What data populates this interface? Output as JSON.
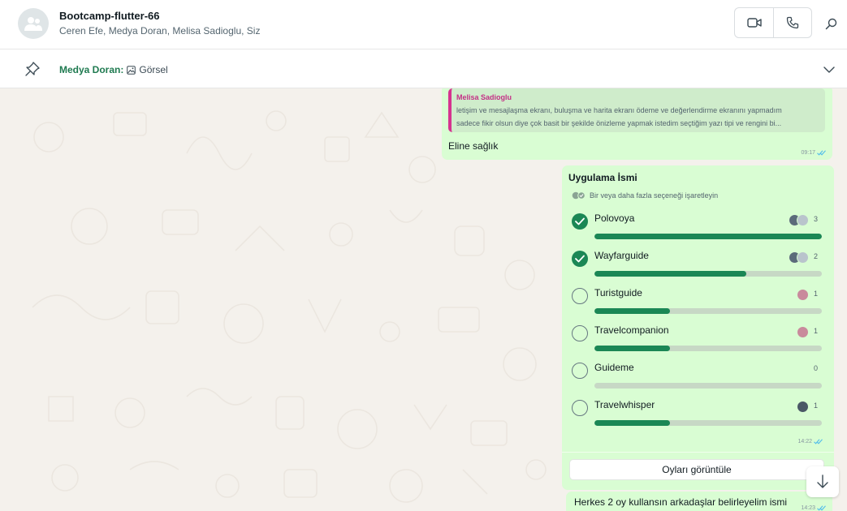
{
  "header": {
    "title": "Bootcamp-flutter-66",
    "members": "Ceren Efe, Medya Doran, Melisa Sadioglu, Siz",
    "icons": {
      "avatar": "group-avatar-icon",
      "video": "video-call-icon",
      "voice": "voice-call-icon",
      "search": "search-icon"
    }
  },
  "pinned": {
    "sender": "Medya Doran:",
    "message": "Görsel",
    "icons": {
      "pin": "pin-icon",
      "image": "image-icon",
      "expand": "chevron-down-icon"
    }
  },
  "messages": {
    "reply": {
      "quote_author": "Melisa Sadioglu",
      "quote_line1": "letişim ve mesajlaşma ekranı, buluşma ve harita ekranı ödeme ve değerlendirme ekranını yapmadım",
      "quote_line2": "sadece fikir olsun diye çok basit bir şekilde önizleme yapmak istedim seçtiğim yazı tipi ve rengini bi...",
      "text": "Eline sağlık",
      "time": "09:17"
    },
    "poll": {
      "title": "Uygulama İsmi",
      "hint": "Bir veya daha fazla seçeneği işaretleyin",
      "time": "14:22",
      "view_votes": "Oyları görüntüle",
      "options": [
        {
          "label": "Polovoya",
          "votes": "3",
          "checked": true,
          "fraction": 1.0
        },
        {
          "label": "Wayfarguide",
          "votes": "2",
          "checked": true,
          "fraction": 0.667
        },
        {
          "label": "Turistguide",
          "votes": "1",
          "checked": false,
          "fraction": 0.333
        },
        {
          "label": "Travelcompanion",
          "votes": "1",
          "checked": false,
          "fraction": 0.333
        },
        {
          "label": "Guideme",
          "votes": "0",
          "checked": false,
          "fraction": 0
        },
        {
          "label": "Travelwhisper",
          "votes": "1",
          "checked": false,
          "fraction": 0.333
        }
      ]
    },
    "last": {
      "text": "Herkes 2 oy kullansın arkadaşlar belirleyelim ismi",
      "time": "14:23"
    }
  },
  "colors": {
    "accent": "#1b8755",
    "bubble": "#d9fdd3",
    "quote_author": "#c42f86",
    "read_ticks": "#53bdeb"
  }
}
